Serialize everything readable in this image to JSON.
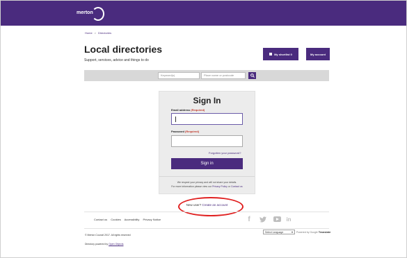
{
  "header": {
    "logo_text": "merton",
    "brand_color": "#4a2b7e"
  },
  "breadcrumb": {
    "home": "Home",
    "separator": ">",
    "current": "Directories"
  },
  "page": {
    "title": "Local directories",
    "subtitle": "Support, services, advice and things to do"
  },
  "actions": {
    "shortlist_label": "My shortlist 0",
    "account_label": "My account"
  },
  "search": {
    "keyword_placeholder": "Keyword(s)",
    "place_placeholder": "Place name or postcode",
    "search_icon": "search-icon"
  },
  "signin": {
    "title": "Sign In",
    "email_label": "Email address",
    "password_label": "Password",
    "required_text": "(Required)",
    "email_value": "",
    "password_value": "",
    "forgotten_link": "Forgotten your password?",
    "submit_label": "Sign in",
    "privacy_line1": "We respect your privacy and will not share your details.",
    "privacy_line2_prefix": "For more information please view our",
    "privacy_link": "Privacy Policy",
    "privacy_or": "or",
    "contact_link": "Contact us"
  },
  "new_user": {
    "prompt": "New user?",
    "create_link": "Create an account",
    "highlight_color": "#e02020"
  },
  "footer": {
    "links": [
      "Contact us",
      "Cookies",
      "Accessibility",
      "Privacy Notice"
    ],
    "social_icons": [
      "facebook-icon",
      "twitter-icon",
      "youtube-icon",
      "linkedin-icon"
    ],
    "copyright": "© Merton Council 2017. All rights reserved",
    "powered_prefix": "Directory powered by",
    "powered_link": "Open Objects",
    "language_select": "Select Language",
    "translate_prefix": "Powered by",
    "translate_google": "Google",
    "translate_label": "Translate"
  }
}
